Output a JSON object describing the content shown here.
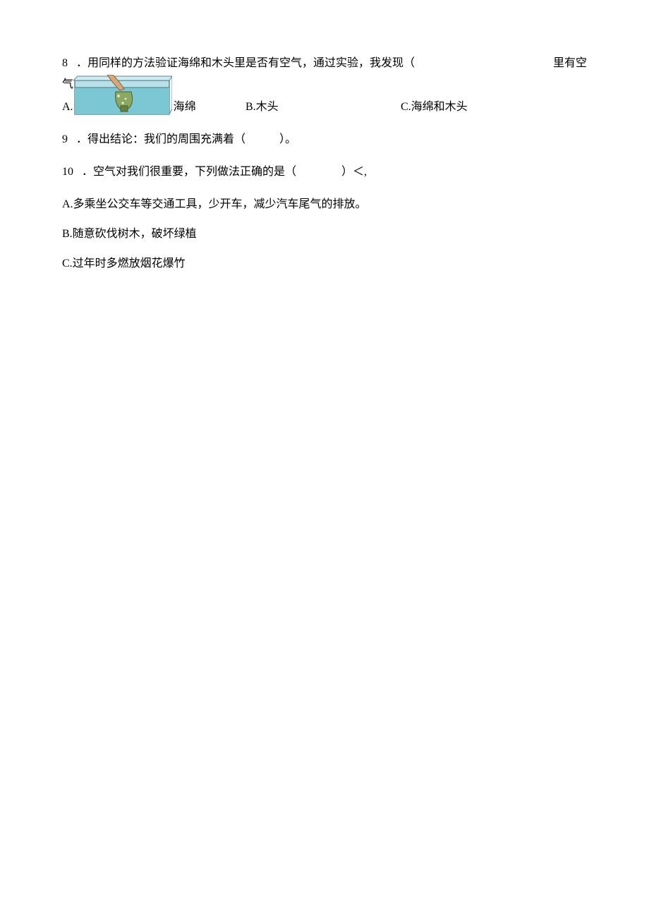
{
  "q8": {
    "number": "8",
    "stem": "．用同样的方法验证海绵和木头里是否有空气，通过实验，我发现（",
    "tail": "里有空",
    "qi": "气",
    "options": {
      "a_prefix": "A.",
      "a_label": "海绵",
      "b": "B.木头",
      "c": "C.海绵和木头"
    }
  },
  "q9": {
    "number": "9",
    "text": "．得出结论：我们的周围充满着（　　　）。"
  },
  "q10": {
    "number": "10",
    "text_before": "．空气对我们很重要，下列做法正确的是（　　　　）",
    "lt": "＜,",
    "options": {
      "a": "A.多乘坐公交车等交通工具，少开车，减少汽车尾气的排放。",
      "b": "B.随意砍伐树木，破坏绿植",
      "c": "C.过年时多燃放烟花爆竹"
    }
  }
}
